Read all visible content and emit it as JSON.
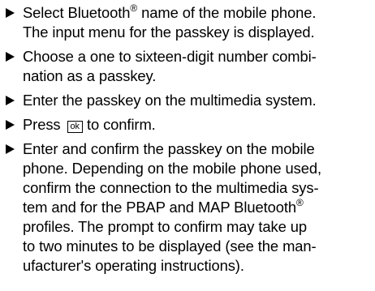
{
  "steps": [
    {
      "lines": [
        [
          "Select Bluetooth",
          "®",
          " name of the mobile phone."
        ],
        [
          "The input menu for the passkey is displayed."
        ]
      ]
    },
    {
      "lines": [
        [
          "Choose a one to sixteen-digit number combi-"
        ],
        [
          "nation as a passkey."
        ]
      ]
    },
    {
      "lines": [
        [
          "Enter the passkey on the multimedia system."
        ]
      ]
    },
    {
      "lines": [
        [
          "Press",
          "ok",
          "to confirm."
        ]
      ]
    },
    {
      "lines": [
        [
          "Enter and confirm the passkey on the mobile"
        ],
        [
          "phone. Depending on the mobile phone used,"
        ],
        [
          "confirm the connection to the multimedia sys-"
        ],
        [
          "tem and for the PBAP and MAP Bluetooth",
          "®"
        ],
        [
          "profiles. The prompt to confirm may take up"
        ],
        [
          "to two minutes to be displayed (see the man-"
        ],
        [
          "ufacturer's operating instructions)."
        ]
      ]
    }
  ]
}
